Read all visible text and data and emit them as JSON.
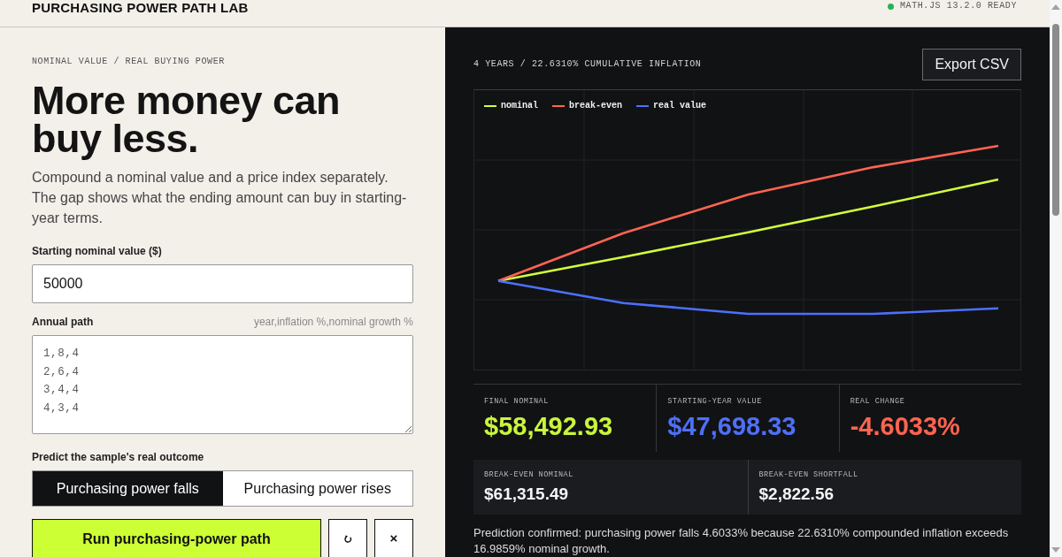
{
  "header": {
    "title": "PURCHASING POWER PATH LAB",
    "status": "MATH.JS 13.2.0 READY"
  },
  "intro": {
    "eyebrow": "NOMINAL VALUE / REAL BUYING POWER",
    "heading": "More money can buy less.",
    "body": "Compound a nominal value and a price index separately. The gap shows what the ending amount can buy in starting-year terms."
  },
  "form": {
    "start_label": "Starting nominal value ($)",
    "start_value": "50000",
    "path_label": "Annual path",
    "path_hint": "year,inflation %,nominal growth %",
    "path_value": "1,8,4\n2,6,4\n3,4,4\n4,3,4",
    "predict_label": "Predict the sample's real outcome",
    "options": [
      {
        "label": "Purchasing power falls",
        "selected": true
      },
      {
        "label": "Purchasing power rises",
        "selected": false
      }
    ],
    "run_button": "Run purchasing-power path",
    "clear_button": "×"
  },
  "results": {
    "chart_title": "4 YEARS / 22.6310% CUMULATIVE INFLATION",
    "export_button": "Export CSV",
    "legend": [
      {
        "label": "nominal",
        "color": "#d2ff3c"
      },
      {
        "label": "break-even",
        "color": "#ff6452"
      },
      {
        "label": "real value",
        "color": "#4d70ff"
      }
    ],
    "metrics": [
      {
        "label": "FINAL NOMINAL",
        "value": "$58,492.93",
        "color": "#c9f63b"
      },
      {
        "label": "STARTING-YEAR VALUE",
        "value": "$47,698.33",
        "color": "#4f6ff7"
      },
      {
        "label": "REAL CHANGE",
        "value": "-4.6033%",
        "color": "#ff6450"
      }
    ],
    "break_even": [
      {
        "label": "BREAK-EVEN NOMINAL",
        "value": "$61,315.49"
      },
      {
        "label": "BREAK-EVEN SHORTFALL",
        "value": "$2,822.56"
      }
    ],
    "prediction": "Prediction confirmed: purchasing power falls 4.6033% because 22.6310% compounded inflation exceeds 16.9859% nominal growth."
  }
}
